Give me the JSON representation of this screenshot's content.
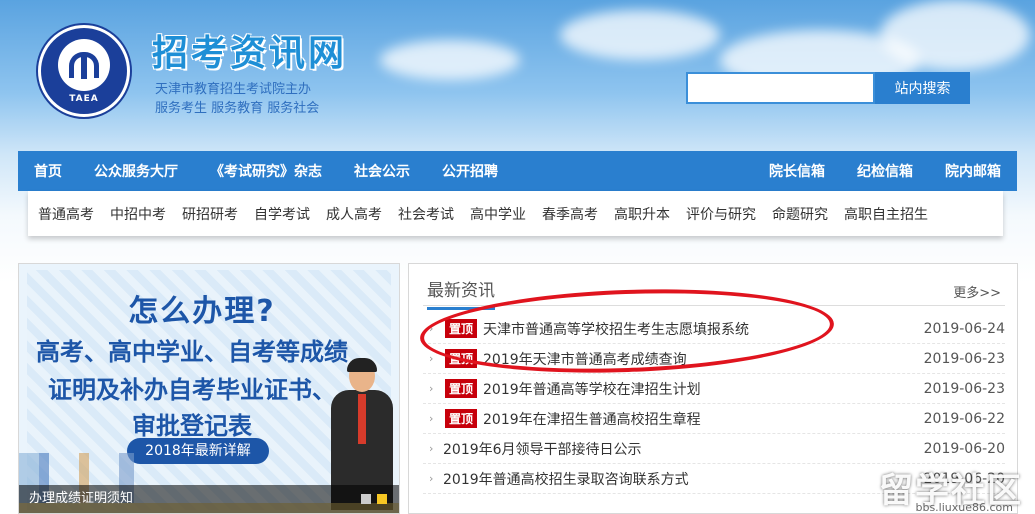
{
  "header": {
    "logo_text": "TAEA",
    "site_title": "招考资讯网",
    "subtitle_line1": "天津市教育招生考试院主办",
    "subtitle_line2": "服务考生 服务教育 服务社会",
    "search_placeholder": "",
    "search_button": "站内搜索"
  },
  "nav": {
    "left": [
      "首页",
      "公众服务大厅",
      "《考试研究》杂志",
      "社会公示",
      "公开招聘"
    ],
    "right": [
      "院长信箱",
      "纪检信箱",
      "院内邮箱"
    ]
  },
  "subnav": [
    "普通高考",
    "中招中考",
    "研招研考",
    "自学考试",
    "成人高考",
    "社会考试",
    "高中学业",
    "春季高考",
    "高职升本",
    "评价与研究",
    "命题研究",
    "高职自主招生"
  ],
  "banner": {
    "title": "怎么办理?",
    "line1": "高考、高中学业、自考等成绩",
    "line2": "证明及补办自考毕业证书、",
    "line3": "审批登记表",
    "pill": "2018年最新详解",
    "caption": "办理成绩证明须知"
  },
  "news": {
    "title": "最新资讯",
    "more": "更多>>",
    "items": [
      {
        "badge": "置顶",
        "text": "天津市普通高等学校招生考生志愿填报系统",
        "date": "2019-06-24"
      },
      {
        "badge": "置顶",
        "text": "2019年天津市普通高考成绩查询",
        "date": "2019-06-23"
      },
      {
        "badge": "置顶",
        "text": "2019年普通高等学校在津招生计划",
        "date": "2019-06-23"
      },
      {
        "badge": "置顶",
        "text": "2019年在津招生普通高校招生章程",
        "date": "2019-06-22"
      },
      {
        "badge": "",
        "text": "2019年6月领导干部接待日公示",
        "date": "2019-06-20"
      },
      {
        "badge": "",
        "text": "2019年普通高校招生录取咨询联系方式",
        "date": "2019-06-20"
      }
    ]
  },
  "watermark": {
    "big": "留学社区",
    "small": "bbs.liuxue86.com"
  },
  "colors": {
    "nav_blue": "#2a7fcf",
    "badge_red": "#c7000b",
    "annotation_red": "#e0141e",
    "title_blue": "#1e8fd6"
  }
}
